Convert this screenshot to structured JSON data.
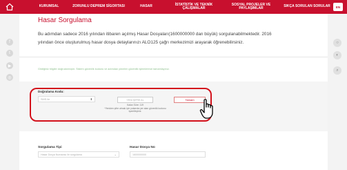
{
  "nav": {
    "items": [
      "KURUMSAL",
      "ZORUNLU DEPREM SİGORTASI",
      "HASAR",
      "İSTATİSTİK VE TEKNİK\nÇALIŞMALAR",
      "SOSYAL PROJELER VE\nPAYLAŞIMLAR",
      "SIKÇA SORULAN SORULAR"
    ],
    "lang": "EN"
  },
  "page": {
    "title": "Hasar Sorgulama",
    "description": "Bu adımdan sadece 2016 yılından itibaren açılmış Hasar Dosyaları(1600000000 dan büyük) sorgulanabilmektedir. 2016 yılından önce oluşturulmuş hasar dosya detaylarınızı ALO125 çağrı merkezimizi arayarak öğrenebilirsiniz.",
    "notice": "Girdiğiniz bilgiler doğrulanmıştır. Sistem güvenlik kodunu ve adımdan yönelen güvenlik işlemlerinizi tamamlayınız."
  },
  "verification": {
    "label": "Doğrulama Kodu:",
    "select_value": "SMS ile",
    "new_code_button": "YENİ ŞİFRE AL",
    "remaining": "Kalan Süre: 119",
    "note": "*Yeniden şifre almak için yukarıda yer alan güvenlik kodunu işaretleyiniz.",
    "done_button": "Tamam"
  },
  "search": {
    "type_label": "Sorgulama Tipi",
    "type_value": "Hasar Dosya Numarası ile sorgulama",
    "number_label": "Hasar Dosya No",
    "number_value": "1600000000"
  },
  "colors": {
    "brand": "#c8102e",
    "highlight": "#d3111b"
  }
}
